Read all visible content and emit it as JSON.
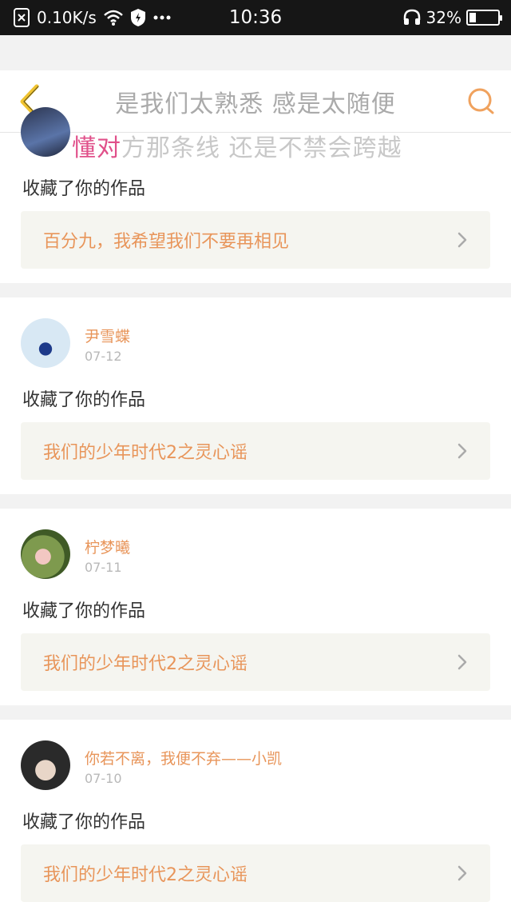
{
  "status_bar": {
    "speed": "0.10K/s",
    "time": "10:36",
    "battery": "32%",
    "battery_level": 0.32,
    "icons": [
      "no-sim-icon",
      "wifi-icon",
      "vpn-shield-icon",
      "more-dots-icon",
      "headset-icon",
      "battery-icon"
    ]
  },
  "header": {
    "title": "是我们太熟悉 感是太随便",
    "back_icon": "back-chevron-icon",
    "search_icon": "search-icon",
    "accent_color": "#f0a25e"
  },
  "lyric_overlay": {
    "highlight": "懂对",
    "rest": "方那条线 还是不禁会跨越"
  },
  "notifications": [
    {
      "user": "",
      "date": "",
      "action": "收藏了你的作品",
      "work": "百分九，我希望我们不要再相见"
    },
    {
      "user": "尹雪蝶",
      "date": "07-12",
      "action": "收藏了你的作品",
      "work": "我们的少年时代2之灵心谣"
    },
    {
      "user": "柠梦曦",
      "date": "07-11",
      "action": "收藏了你的作品",
      "work": "我们的少年时代2之灵心谣"
    },
    {
      "user": "你若不离，我便不弃——小凯",
      "date": "07-10",
      "action": "收藏了你的作品",
      "work": "我们的少年时代2之灵心谣"
    }
  ]
}
